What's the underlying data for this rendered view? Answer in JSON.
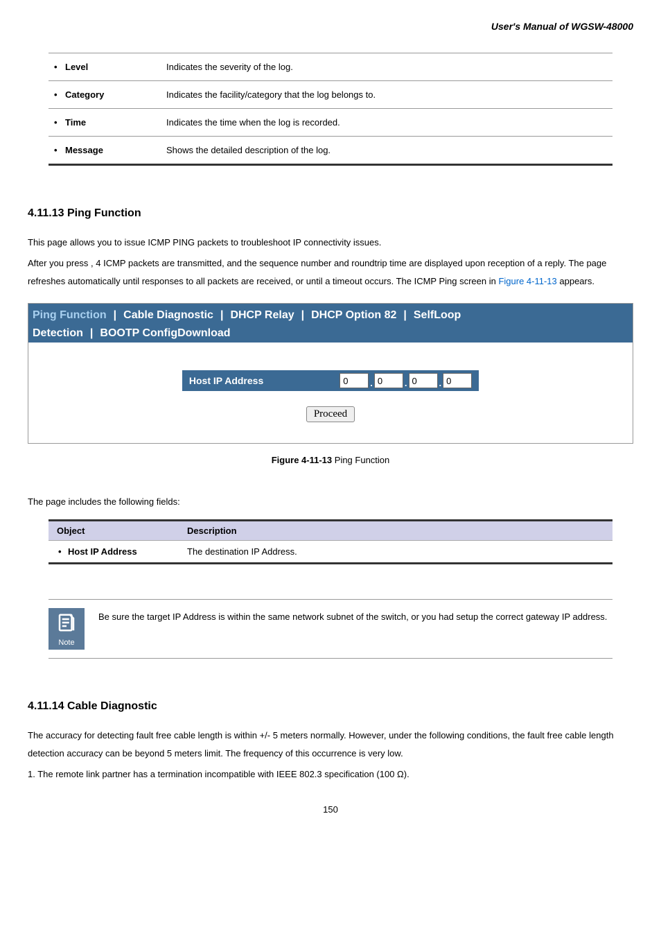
{
  "header": {
    "title": "User's Manual of WGSW-48000"
  },
  "defs": [
    {
      "label": "Level",
      "desc": "Indicates the severity of the log."
    },
    {
      "label": "Category",
      "desc": "Indicates the facility/category that the log belongs to."
    },
    {
      "label": "Time",
      "desc": "Indicates the time when the log is recorded."
    },
    {
      "label": "Message",
      "desc": "Shows the detailed description of the log."
    }
  ],
  "section1": {
    "heading": "4.11.13 Ping Function",
    "p1": "This page allows you to issue ICMP PING packets to troubleshoot IP connectivity issues.",
    "p2a": "After you press , 4 ICMP packets are transmitted, and the sequence number and roundtrip time are displayed upon reception of a reply. The page refreshes automatically until responses to all packets are received, or until a timeout occurs. The ICMP Ping screen in ",
    "p2_link": "Figure 4-11-13",
    "p2b": " appears."
  },
  "ui": {
    "tabs": {
      "ping": "Ping Function",
      "cable": "Cable Diagnostic",
      "dhcp_relay": "DHCP Relay",
      "dhcp_opt": "DHCP Option 82",
      "selfloop": "SelfLoop",
      "detection": "Detection",
      "bootp": "BOOTP ConfigDownload"
    },
    "form": {
      "label": "Host IP Address",
      "octets": [
        "0",
        "0",
        "0",
        "0"
      ],
      "button": "Proceed"
    }
  },
  "figure": {
    "bold": "Figure 4-11-13",
    "rest": " Ping Function"
  },
  "fields_intro": "The page includes the following fields:",
  "obj_table": {
    "h1": "Object",
    "h2": "Description",
    "r1_label": "Host IP Address",
    "r1_desc": "The destination IP Address."
  },
  "note": {
    "label": "Note",
    "text": "Be sure the target IP Address is within the same network subnet of the switch, or you had setup the correct gateway IP address."
  },
  "section2": {
    "heading": "4.11.14 Cable Diagnostic",
    "p1": "The accuracy for detecting fault free cable length is within +/- 5 meters normally. However, under the following conditions, the fault free cable length detection accuracy can be beyond 5 meters limit. The frequency of this occurrence is very low.",
    "li1": "1. The remote link partner has a termination incompatible with IEEE 802.3 specification (100 Ω)."
  },
  "page_number": "150"
}
